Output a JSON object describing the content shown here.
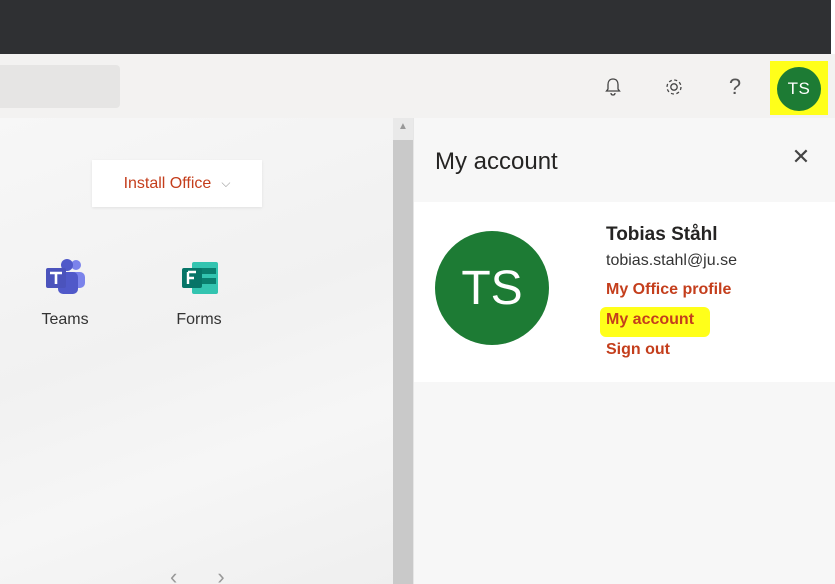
{
  "header": {
    "notifications_icon": "bell-icon",
    "settings_icon": "gear-icon",
    "help_label": "?",
    "avatar_initials": "TS"
  },
  "main": {
    "install_label": "Install Office",
    "apps": [
      {
        "label": "Teams",
        "icon": "teams-icon"
      },
      {
        "label": "Forms",
        "icon": "forms-icon"
      }
    ],
    "prev_label": "‹",
    "next_label": "›"
  },
  "panel": {
    "title": "My account",
    "close_label": "✕",
    "avatar_initials": "TS",
    "name": "Tobias Ståhl",
    "email": "tobias.stahl@ju.se",
    "links": {
      "profile": "My Office profile",
      "account": "My account",
      "signout": "Sign out"
    }
  },
  "colors": {
    "accent": "#c43e1c",
    "avatar": "#1d7b34",
    "highlight": "#ffff1a",
    "topbar": "#2f3033"
  }
}
